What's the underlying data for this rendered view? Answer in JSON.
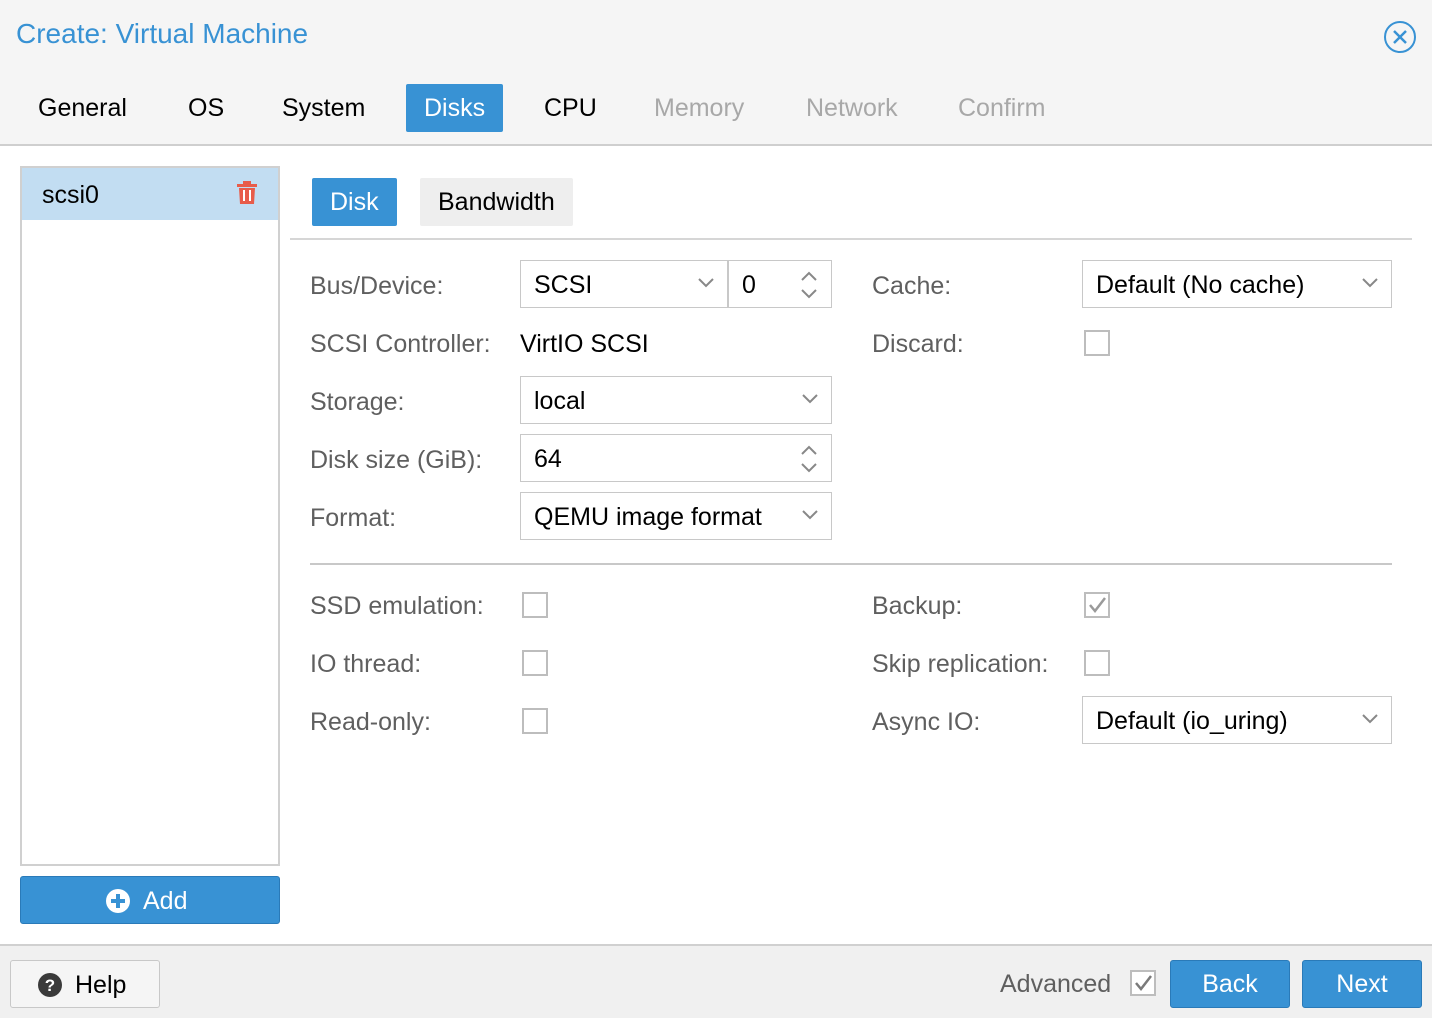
{
  "window": {
    "title": "Create: Virtual Machine"
  },
  "tabs": [
    {
      "label": "General",
      "state": "normal"
    },
    {
      "label": "OS",
      "state": "normal"
    },
    {
      "label": "System",
      "state": "normal"
    },
    {
      "label": "Disks",
      "state": "active"
    },
    {
      "label": "CPU",
      "state": "normal"
    },
    {
      "label": "Memory",
      "state": "disabled"
    },
    {
      "label": "Network",
      "state": "disabled"
    },
    {
      "label": "Confirm",
      "state": "disabled"
    }
  ],
  "disk_list": {
    "items": [
      {
        "label": "scsi0"
      }
    ],
    "add_label": "Add"
  },
  "subtabs": [
    {
      "label": "Disk",
      "state": "active"
    },
    {
      "label": "Bandwidth",
      "state": "normal"
    }
  ],
  "form": {
    "bus_device": {
      "label": "Bus/Device:",
      "bus": "SCSI",
      "device": "0"
    },
    "scsi_controller": {
      "label": "SCSI Controller:",
      "value": "VirtIO SCSI"
    },
    "storage": {
      "label": "Storage:",
      "value": "local"
    },
    "disk_size": {
      "label": "Disk size (GiB):",
      "value": "64"
    },
    "format": {
      "label": "Format:",
      "value": "QEMU image format"
    },
    "cache": {
      "label": "Cache:",
      "value": "Default (No cache)"
    },
    "discard": {
      "label": "Discard:",
      "checked": false
    },
    "ssd_emulation": {
      "label": "SSD emulation:",
      "checked": false
    },
    "io_thread": {
      "label": "IO thread:",
      "checked": false
    },
    "read_only": {
      "label": "Read-only:",
      "checked": false
    },
    "backup": {
      "label": "Backup:",
      "checked": true
    },
    "skip_replication": {
      "label": "Skip replication:",
      "checked": false
    },
    "async_io": {
      "label": "Async IO:",
      "value": "Default (io_uring)"
    }
  },
  "footer": {
    "help_label": "Help",
    "advanced_label": "Advanced",
    "advanced_checked": true,
    "back_label": "Back",
    "next_label": "Next"
  },
  "colors": {
    "accent": "#3892d4",
    "selected_row": "#c2ddf2",
    "delete": "#e85c4a",
    "disabled_text": "#a8a8a8",
    "label_text": "#5f5f5f"
  }
}
